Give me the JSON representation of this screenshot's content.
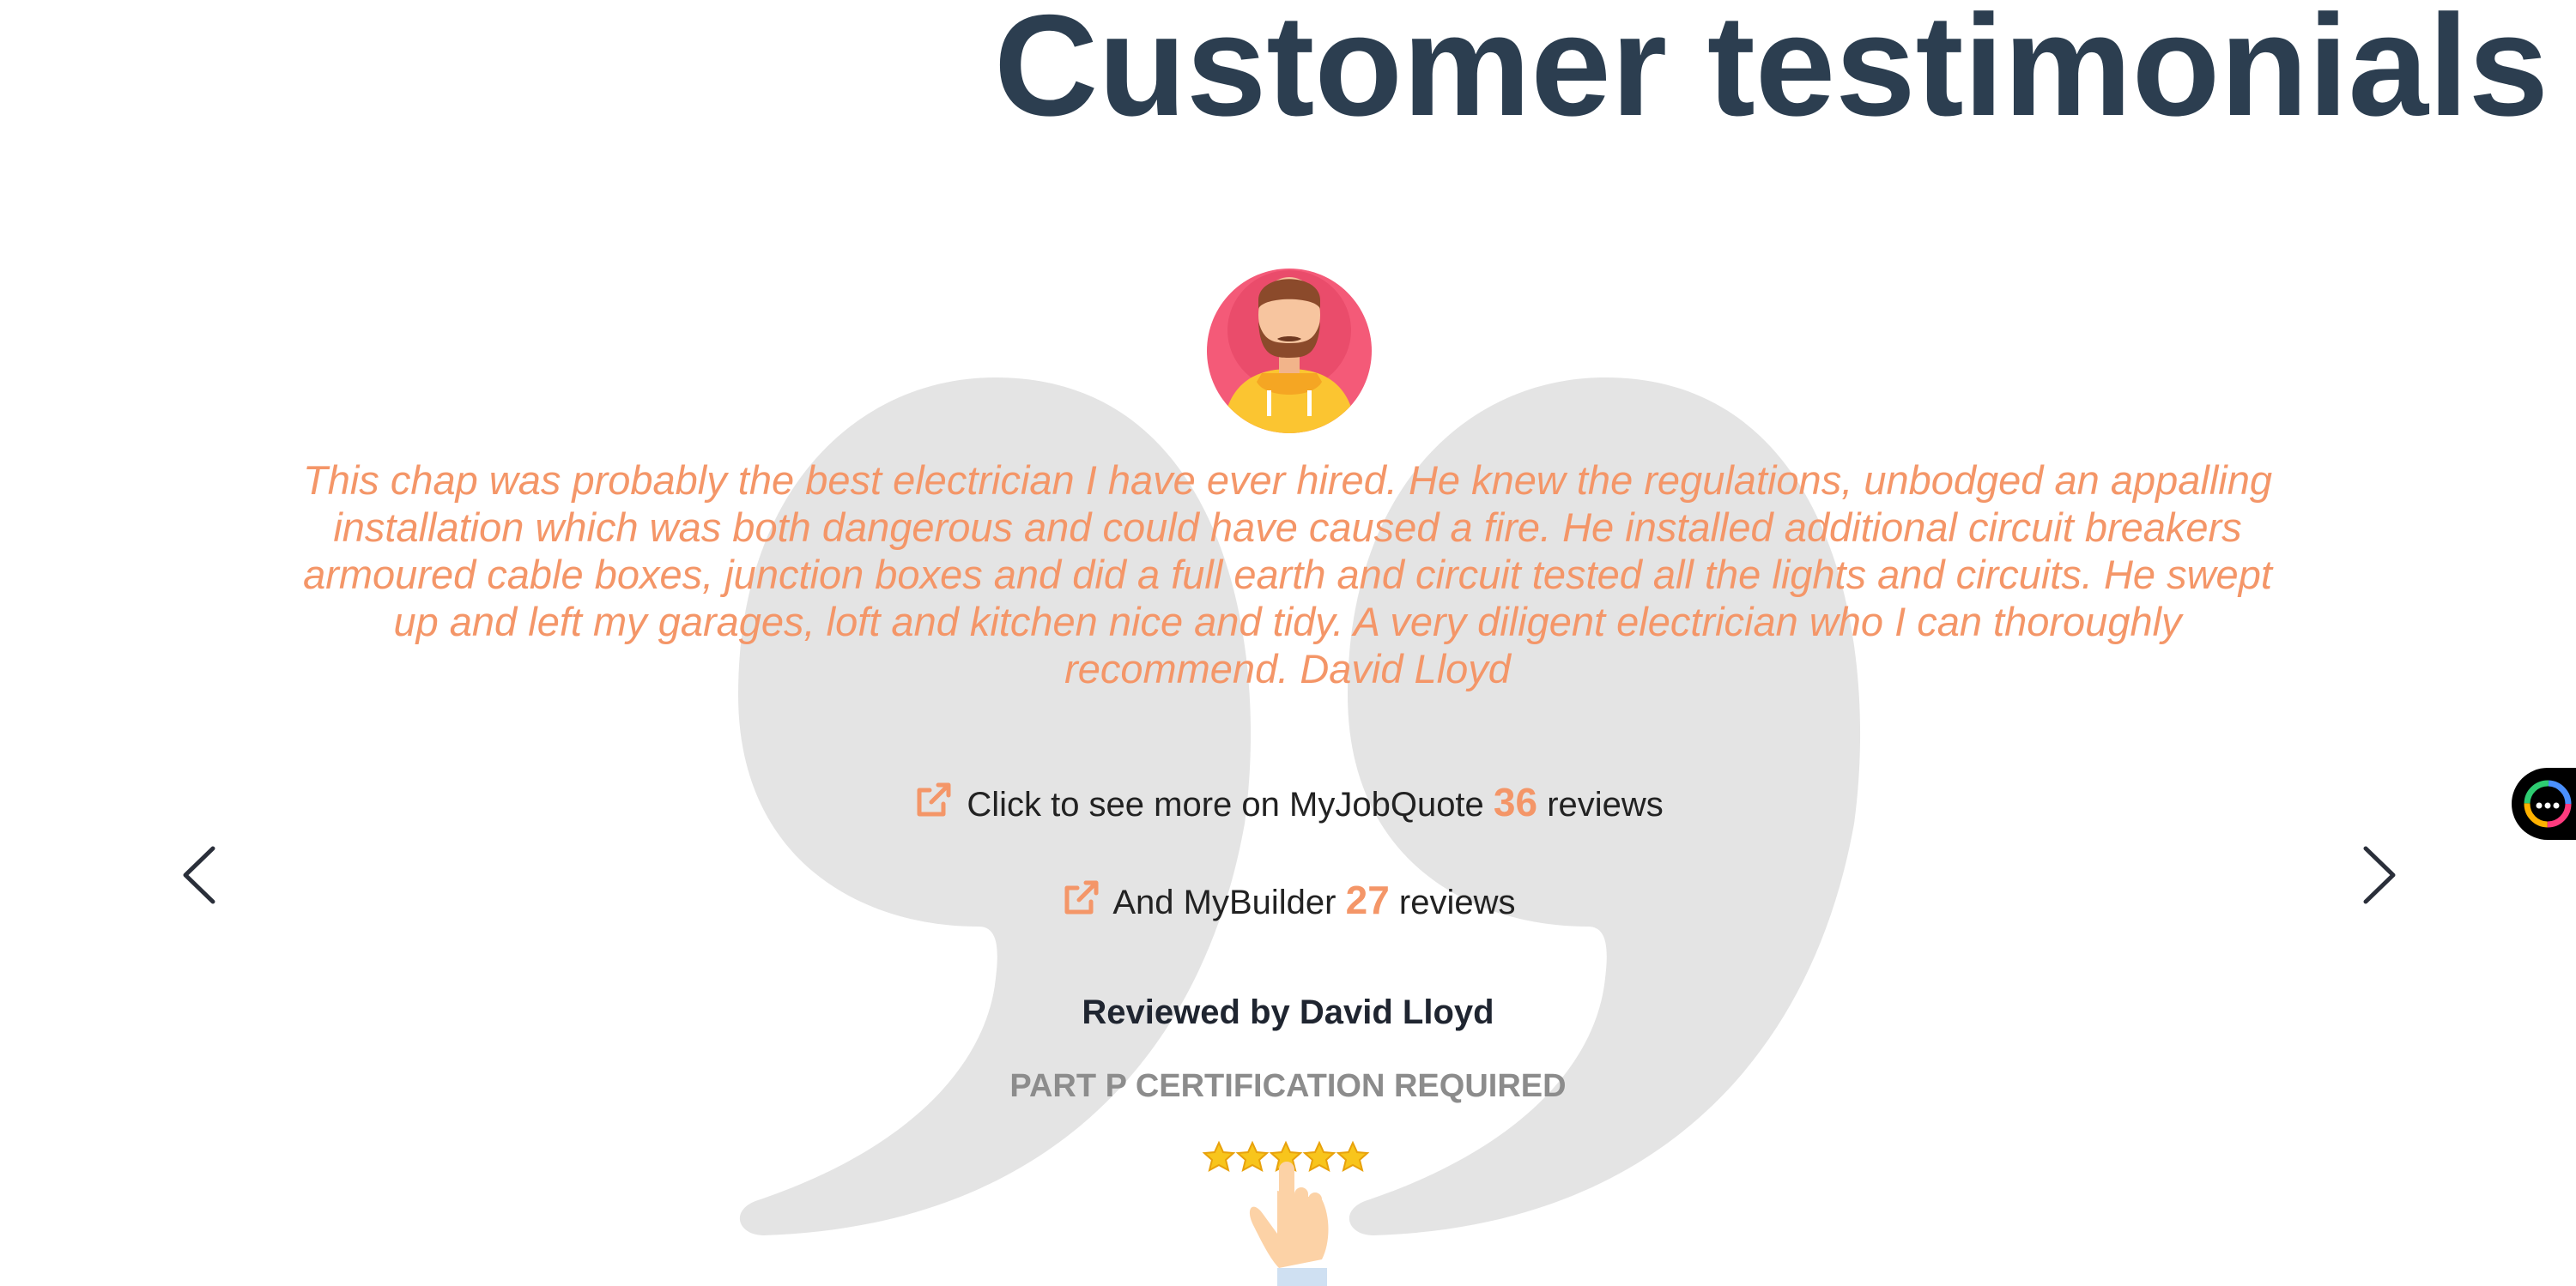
{
  "header": {
    "title": "Customer testimonials"
  },
  "testimonial": {
    "quote": "This chap was probably the best electrician I have ever hired. He knew the regulations, unbodged an appalling installation which was both dangerous and could have caused a fire. He installed additional circuit breakers armoured cable boxes, junction boxes and did a full earth and circuit tested all the lights and circuits. He swept up and left my garages, loft and kitchen nice and tidy. A very diligent electrician who I can thoroughly recommend. David Lloyd",
    "reviewer": "Reviewed by David Lloyd",
    "job_title": "PART P CERTIFICATION REQUIRED",
    "rating": 5,
    "rating_max": 5
  },
  "links": {
    "myjobquote": {
      "prefix": "Click to see more on MyJobQuote",
      "count": "36",
      "suffix": "reviews"
    },
    "mybuilder": {
      "prefix": "And MyBuilder",
      "count": "27",
      "suffix": "reviews"
    }
  },
  "icons": {
    "external_link": "external-link-icon",
    "prev": "chevron-left-icon",
    "next": "chevron-right-icon",
    "chat": "chat-icon"
  },
  "colors": {
    "title": "#2c3e50",
    "accent": "#f49668",
    "quote_mark": "#e4e4e4",
    "cert_text": "#8c8c8c"
  }
}
